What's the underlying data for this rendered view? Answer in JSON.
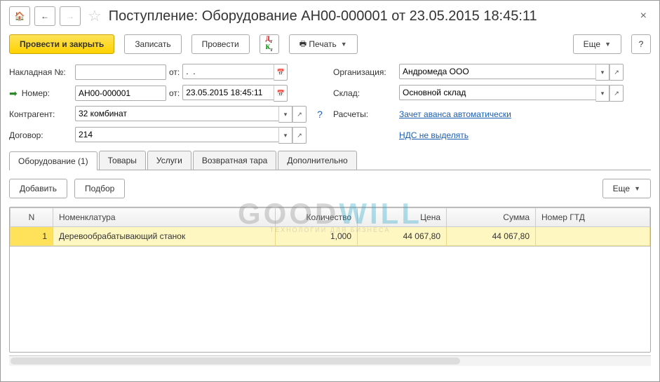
{
  "title": "Поступление: Оборудование АН00-000001 от 23.05.2015 18:45:11",
  "toolbar": {
    "post_close": "Провести и закрыть",
    "save": "Записать",
    "post": "Провести",
    "print": "Печать",
    "more": "Еще",
    "help": "?"
  },
  "form": {
    "invoice_label": "Накладная №:",
    "invoice_no": "",
    "from_label": "от:",
    "invoice_date": ".  .",
    "org_label": "Организация:",
    "org_value": "Андромеда ООО",
    "number_label": "Номер:",
    "number_value": "АН00-000001",
    "number_date": "23.05.2015 18:45:11",
    "warehouse_label": "Склад:",
    "warehouse_value": "Основной склад",
    "counterparty_label": "Контрагент:",
    "counterparty_value": "32 комбинат",
    "settlements_label": "Расчеты:",
    "settlements_link": "Зачет аванса автоматически",
    "contract_label": "Договор:",
    "contract_value": "214",
    "vat_link": "НДС не выделять"
  },
  "tabs": {
    "equipment": "Оборудование (1)",
    "goods": "Товары",
    "services": "Услуги",
    "returnable": "Возвратная тара",
    "additional": "Дополнительно"
  },
  "subtoolbar": {
    "add": "Добавить",
    "pick": "Подбор",
    "more": "Еще"
  },
  "table": {
    "headers": {
      "n": "N",
      "nomenclature": "Номенклатура",
      "qty": "Количество",
      "price": "Цена",
      "sum": "Сумма",
      "gtd": "Номер ГТД"
    },
    "rows": [
      {
        "n": "1",
        "nomenclature": "Деревообрабатывающий станок",
        "qty": "1,000",
        "price": "44 067,80",
        "sum": "44 067,80",
        "gtd": ""
      }
    ]
  },
  "watermark": {
    "brand1": "GOOD",
    "brand2": "WILL",
    "sub": "ТЕХНОЛОГИИ ДЛЯ БИЗНЕСА"
  }
}
